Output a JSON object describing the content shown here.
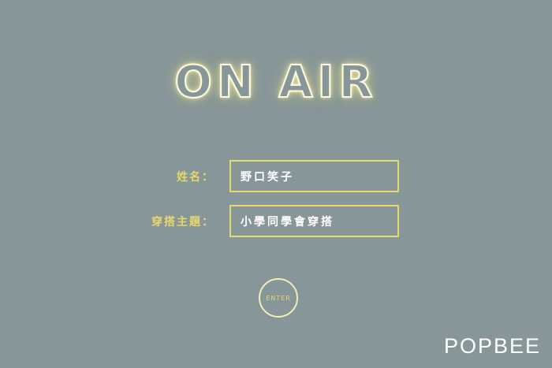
{
  "app": {
    "title": "ON AIR"
  },
  "form": {
    "name_label": "姓名：",
    "name_value": "野口笑子",
    "theme_label": "穿搭主題：",
    "theme_value": "小學同學會穿搭"
  },
  "enter_button": {
    "label": "ENTER"
  },
  "brand": {
    "logo_text": "POPBEE"
  },
  "colors": {
    "background": "#879699",
    "accent_yellow": "#e6d86a",
    "neon_glow": "#fffbe0",
    "text_white": "#ffffff"
  }
}
